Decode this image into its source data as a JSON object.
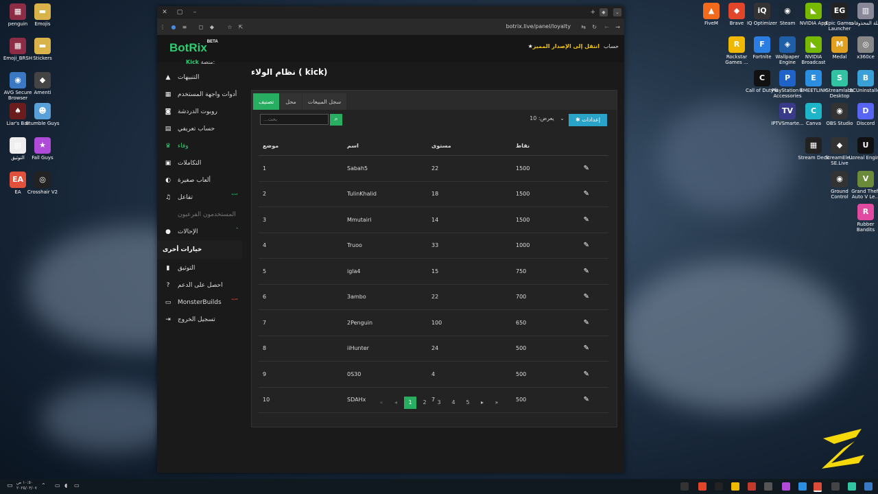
{
  "desktop_left": [
    {
      "label": "penguin",
      "color": "#8e2b45",
      "glyph": "▦"
    },
    {
      "label": "Emojis",
      "color": "#d9b24a",
      "glyph": "▬"
    },
    {
      "label": "Emoji_BRSH",
      "color": "#8e2b45",
      "glyph": "▦"
    },
    {
      "label": "Stickers",
      "color": "#d9b24a",
      "glyph": "▬"
    },
    {
      "label": "AVG Secure Browser",
      "color": "#3a78c4",
      "glyph": "◉"
    },
    {
      "label": "Amenti",
      "color": "#444",
      "glyph": "◆"
    },
    {
      "label": "Liar's Bar",
      "color": "#6b1d1d",
      "glyph": "♠"
    },
    {
      "label": "Stumble Guys",
      "color": "#5aa0d8",
      "glyph": "☻"
    },
    {
      "label": "التوثيق",
      "color": "#eeeeee",
      "glyph": "▤"
    },
    {
      "label": "Fall Guys",
      "color": "#b04ad8",
      "glyph": "★"
    },
    {
      "label": "EA",
      "color": "#e0503a",
      "glyph": "EA"
    },
    {
      "label": "Crosshair V2",
      "color": "#222",
      "glyph": "◎"
    }
  ],
  "desktop_right": [
    {
      "label": "FiveM",
      "color": "#f26b1d",
      "glyph": "▲"
    },
    {
      "label": "Brave",
      "color": "#e1452a",
      "glyph": "◆"
    },
    {
      "label": "IQ Optimizer",
      "color": "#333",
      "glyph": "iQ"
    },
    {
      "label": "Steam",
      "color": "#1b2838",
      "glyph": "◉"
    },
    {
      "label": "NVIDIA App",
      "color": "#76b900",
      "glyph": "◣"
    },
    {
      "label": "Epic Games Launcher",
      "color": "#222",
      "glyph": "EG"
    },
    {
      "label": "سلة المحذوفات",
      "color": "#889",
      "glyph": "▥"
    },
    {
      "label": "Rockstar Games ...",
      "color": "#f0b800",
      "glyph": "R"
    },
    {
      "label": "Fortnite",
      "color": "#2a7de1",
      "glyph": "F"
    },
    {
      "label": "Wallpaper Engine",
      "color": "#1f5fa8",
      "glyph": "◈"
    },
    {
      "label": "NVIDIA Broadcast",
      "color": "#76b900",
      "glyph": "◣"
    },
    {
      "label": "Medal",
      "color": "#e0a020",
      "glyph": "M"
    },
    {
      "label": "x360ce",
      "color": "#888",
      "glyph": "◎"
    },
    {
      "label": "Call of Duty®",
      "color": "#111",
      "glyph": "C"
    },
    {
      "label": "PlayStation® Accessories",
      "color": "#1f62c8",
      "glyph": "P"
    },
    {
      "label": "EMEETLINK",
      "color": "#2c8ee0",
      "glyph": "E"
    },
    {
      "label": "Streamlabs Desktop",
      "color": "#31c3a2",
      "glyph": "S"
    },
    {
      "label": "BCUninstaller",
      "color": "#3aa0d8",
      "glyph": "B"
    },
    {
      "label": "IPTVSmarte...",
      "color": "#3a3a8a",
      "glyph": "TV"
    },
    {
      "label": "Canva",
      "color": "#1fb5c8",
      "glyph": "C"
    },
    {
      "label": "OBS Studio",
      "color": "#333",
      "glyph": "◉"
    },
    {
      "label": "Discord",
      "color": "#5865f2",
      "glyph": "D"
    },
    {
      "label": "Stream Deck",
      "color": "#222",
      "glyph": "▦"
    },
    {
      "label": "StreamEle... SE.Live",
      "color": "#333",
      "glyph": "◆"
    },
    {
      "label": "Unreal Engine",
      "color": "#111",
      "glyph": "U"
    },
    {
      "label": "Ground Control",
      "color": "#333",
      "glyph": "◉"
    },
    {
      "label": "Grand Theft Auto V Le...",
      "color": "#6b8a3a",
      "glyph": "V"
    },
    {
      "label": "Rubber Bandits",
      "color": "#e04aa0",
      "glyph": "R"
    }
  ],
  "browser": {
    "url": "botrix.live/panel/loyalty"
  },
  "app": {
    "logo": "BotRix",
    "logo_badge": "BETA",
    "platform_label": "منصة:",
    "platform_value": "Kick",
    "premium_link": "انتقل إلى الإصدار المميز",
    "account": "حساب"
  },
  "sidebar": {
    "items": [
      {
        "label": "التنبيهات",
        "icon": "warning-icon",
        "glyph": "▲"
      },
      {
        "label": "أدوات واجهة المستخدم",
        "icon": "grid-icon",
        "glyph": "▦"
      },
      {
        "label": "روبوت الدردشة",
        "icon": "robot-icon",
        "glyph": "◙"
      },
      {
        "label": "حساب تعريفي",
        "icon": "id-card-icon",
        "glyph": "▤"
      },
      {
        "label": "وفاء",
        "icon": "trophy-icon",
        "glyph": "♛",
        "active": true
      },
      {
        "label": "التكاملات",
        "icon": "integration-icon",
        "glyph": "▣"
      },
      {
        "label": "ألعاب صغيرة",
        "icon": "gamepad-icon",
        "glyph": "◐"
      },
      {
        "label": "تفاعل",
        "icon": "music-icon",
        "glyph": "♫",
        "badge": "جديد"
      },
      {
        "label": "المستخدمون الفرعيون",
        "icon": "users-icon",
        "glyph": "",
        "dim": true
      },
      {
        "label": "الإحالات",
        "icon": "user-group-icon",
        "glyph": "●",
        "badge": "٭"
      }
    ],
    "other_header": "خيارات أخرى",
    "other_items": [
      {
        "label": "التوثيق",
        "icon": "book-icon",
        "glyph": "▮"
      },
      {
        "label": "احصل على الدعم",
        "icon": "help-icon",
        "glyph": "?"
      },
      {
        "label": "MonsterBuilds",
        "icon": "laptop-icon",
        "glyph": "▭",
        "badge": "جديد",
        "badge_red": true
      },
      {
        "label": "تسجيل الخروج",
        "icon": "logout-icon",
        "glyph": "⇥"
      }
    ]
  },
  "main": {
    "title": "نظام الولاء ( kick)",
    "tabs": [
      {
        "label": "تصنيف",
        "active": true
      },
      {
        "label": "محل"
      },
      {
        "label": "سجل المبيعات"
      }
    ],
    "search_placeholder": "...بحث",
    "settings_label": "إعدادات",
    "per_page_label": "يعرض:",
    "per_page_value": "10",
    "columns": [
      "موضع",
      "اسم",
      "مستوى",
      "نقاط"
    ],
    "rows": [
      {
        "pos": "1",
        "name": "Sabah5",
        "level": "22",
        "points": "1500"
      },
      {
        "pos": "2",
        "name": "TulinKhalid",
        "level": "18",
        "points": "1500"
      },
      {
        "pos": "3",
        "name": "Mmutairi",
        "level": "14",
        "points": "1500"
      },
      {
        "pos": "4",
        "name": "Truoo",
        "level": "33",
        "points": "1000"
      },
      {
        "pos": "5",
        "name": "igla4",
        "level": "15",
        "points": "750"
      },
      {
        "pos": "6",
        "name": "3ambo",
        "level": "22",
        "points": "700"
      },
      {
        "pos": "7",
        "name": "2Penguin",
        "level": "100",
        "points": "650"
      },
      {
        "pos": "8",
        "name": "iiHunter",
        "level": "24",
        "points": "500"
      },
      {
        "pos": "9",
        "name": "0S30",
        "level": "4",
        "points": "500"
      },
      {
        "pos": "10",
        "name": "SDAHx",
        "level": "7",
        "points": "500"
      }
    ],
    "pages": [
      "1",
      "2",
      "3",
      "4",
      "5"
    ],
    "current_page": "1"
  },
  "taskbar": {
    "clock_time": "١٠:٥٠ ص",
    "clock_date": "٢٠٢٥/٠٣/٠٧"
  }
}
